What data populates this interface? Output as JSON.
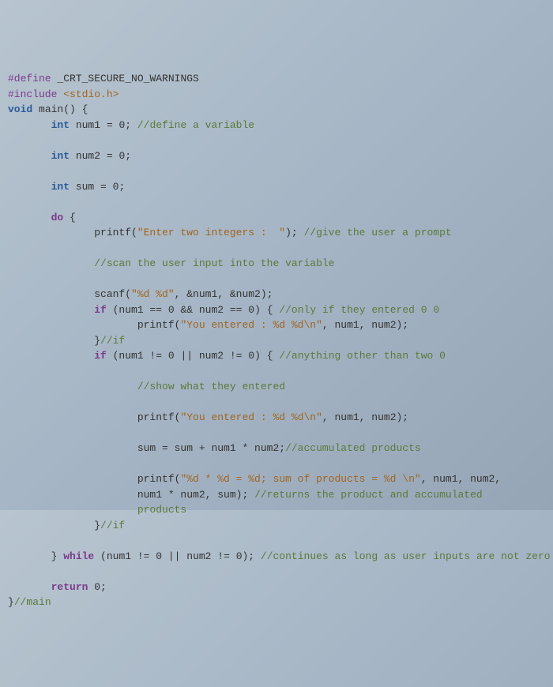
{
  "code": {
    "l1": {
      "a": "#define ",
      "b": "_CRT_SECURE_NO_WARNINGS"
    },
    "l2": {
      "a": "#include ",
      "b": "<stdio.h>"
    },
    "l3": {
      "a": "void",
      "b": " main() {"
    },
    "l4": {
      "a": "int",
      "b": " num1 = ",
      "c": "0",
      "d": "; ",
      "e": "//define a variable"
    },
    "l5": {
      "a": "int",
      "b": " num2 = ",
      "c": "0",
      "d": ";"
    },
    "l6": {
      "a": "int",
      "b": " sum = ",
      "c": "0",
      "d": ";"
    },
    "l7": {
      "a": "do",
      "b": " {"
    },
    "l8": {
      "a": "printf(",
      "b": "\"Enter two integers :  \"",
      "c": "); ",
      "d": "//give the user a prompt"
    },
    "l9": {
      "a": "//scan the user input into the variable"
    },
    "l10": {
      "a": "scanf(",
      "b": "\"%d %d\"",
      "c": ", &num1, &num2);"
    },
    "l11": {
      "a": "if",
      "b": " (num1 == ",
      "c": "0",
      "d": " && num2 == ",
      "e": "0",
      "f": ") { ",
      "g": "//only if they entered 0 0"
    },
    "l12": {
      "a": "printf(",
      "b": "\"You entered : %d %d\\n\"",
      "c": ", num1, num2);"
    },
    "l13": {
      "a": "}",
      "b": "//if"
    },
    "l14": {
      "a": "if",
      "b": " (num1 != ",
      "c": "0",
      "d": " || num2 != ",
      "e": "0",
      "f": ") { ",
      "g": "//anything other than two 0"
    },
    "l15": {
      "a": "//show what they entered"
    },
    "l16": {
      "a": "printf(",
      "b": "\"You entered : %d %d\\n\"",
      "c": ", num1, num2);"
    },
    "l17": {
      "a": "sum = sum + num1 * num2;",
      "b": "//accumulated products"
    },
    "l18": {
      "a": "printf(",
      "b": "\"%d * %d = %d; sum of products = %d \\n\"",
      "c": ", num1, num2,"
    },
    "l19": {
      "a": "num1 * num2, sum); ",
      "b": "//returns the product and accumulated"
    },
    "l20": {
      "a": "products"
    },
    "l21": {
      "a": "}",
      "b": "//if"
    },
    "l22": {
      "a": "} ",
      "b": "while",
      "c": " (num1 != ",
      "d": "0",
      "e": " || num2 != ",
      "f": "0",
      "g": "); ",
      "h": "//continues as long as user inputs are not zero"
    },
    "l23": {
      "a": "return",
      "b": " ",
      "c": "0",
      "d": ";"
    },
    "l24": {
      "a": "}",
      "b": "//main"
    }
  }
}
